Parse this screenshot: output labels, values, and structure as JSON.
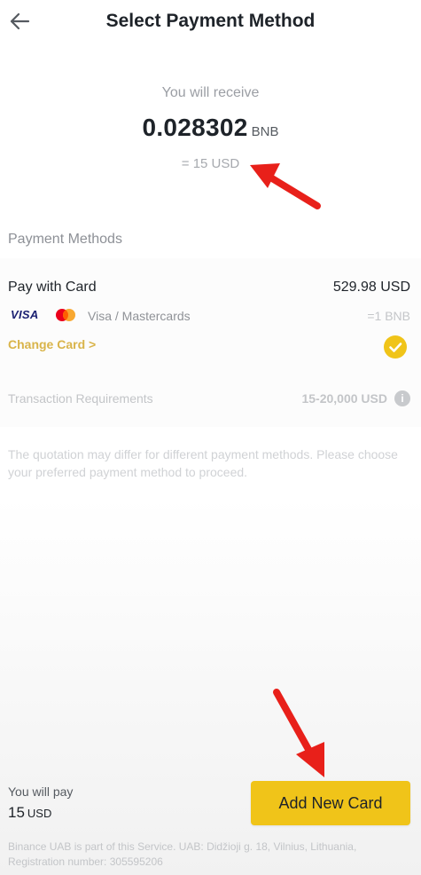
{
  "header": {
    "back_icon": "arrow-left-icon",
    "title": "Select Payment Method"
  },
  "receive": {
    "label": "You will receive",
    "amount": "0.028302",
    "unit": "BNB",
    "usd_equivalent": "= 15 USD"
  },
  "payment_methods": {
    "section_title": "Payment Methods",
    "card": {
      "label": "Pay with Card",
      "amount": "529.98 USD",
      "visa_logo": "VISA",
      "mastercard_icon": "mastercard-logo-icon",
      "types": "Visa / Mastercards",
      "rate": "=1 BNB",
      "change_card": "Change Card >",
      "selected_icon": "check-circle-icon"
    },
    "requirements": {
      "label": "Transaction Requirements",
      "value": "15-20,000 USD",
      "info_icon": "info-icon",
      "info_glyph": "i"
    },
    "note": "The quotation may differ for different payment methods. Please choose your preferred payment method to proceed."
  },
  "footer": {
    "pay_label": "You will pay",
    "pay_amount": "15",
    "pay_unit": "USD",
    "add_card_button": "Add New Card",
    "legal": "Binance UAB is part of this Service. UAB: Didžioji g. 18, Vilnius, Lithuania, Registration number: 305595206"
  },
  "colors": {
    "accent_yellow": "#f0c419",
    "change_card_text": "#d9b44a",
    "annotation_red": "#e8201a",
    "text_primary": "#1e2329"
  }
}
